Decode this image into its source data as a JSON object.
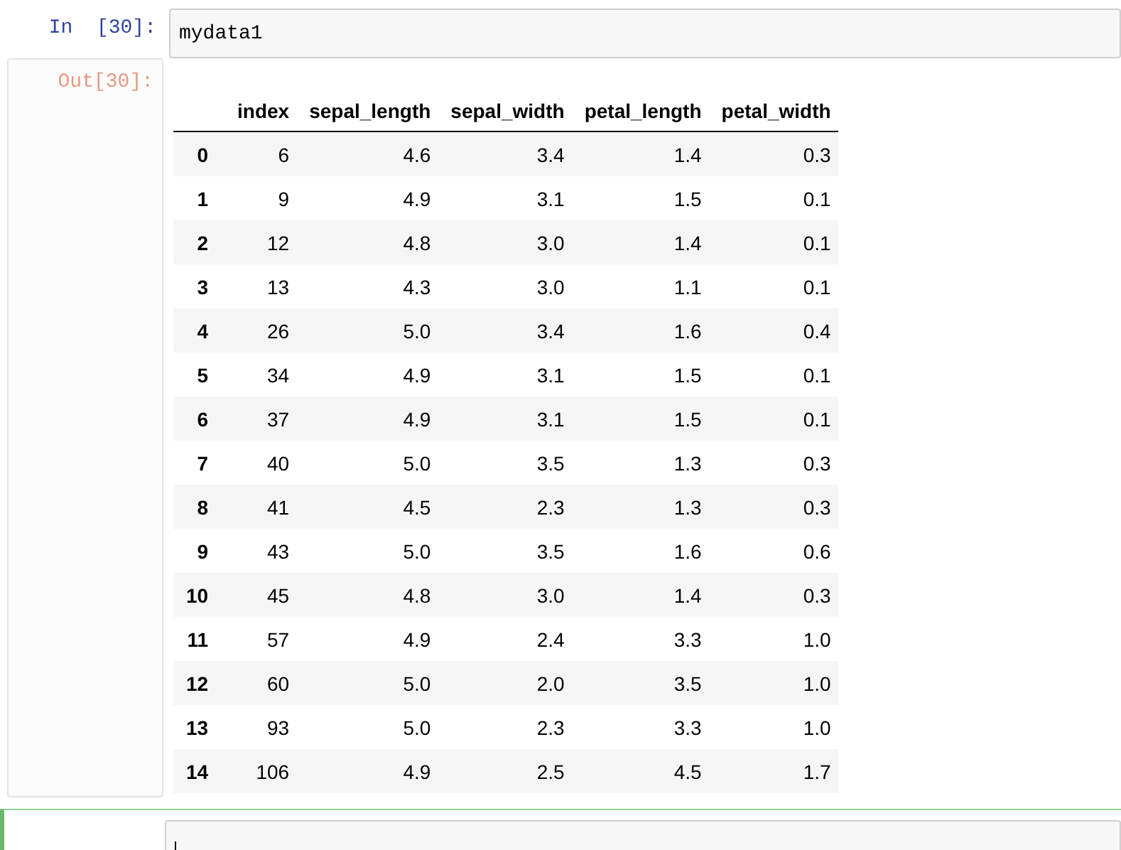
{
  "cells": [
    {
      "kind": "code",
      "prompt": "In  [30]:",
      "source": "mydata1",
      "selected": false,
      "output": {
        "prompt": "Out[30]:",
        "table": {
          "columns": [
            "index",
            "sepal_length",
            "sepal_width",
            "petal_length",
            "petal_width"
          ],
          "rows": [
            {
              "label": "0",
              "values": [
                "6",
                "4.6",
                "3.4",
                "1.4",
                "0.3"
              ]
            },
            {
              "label": "1",
              "values": [
                "9",
                "4.9",
                "3.1",
                "1.5",
                "0.1"
              ]
            },
            {
              "label": "2",
              "values": [
                "12",
                "4.8",
                "3.0",
                "1.4",
                "0.1"
              ]
            },
            {
              "label": "3",
              "values": [
                "13",
                "4.3",
                "3.0",
                "1.1",
                "0.1"
              ]
            },
            {
              "label": "4",
              "values": [
                "26",
                "5.0",
                "3.4",
                "1.6",
                "0.4"
              ]
            },
            {
              "label": "5",
              "values": [
                "34",
                "4.9",
                "3.1",
                "1.5",
                "0.1"
              ]
            },
            {
              "label": "6",
              "values": [
                "37",
                "4.9",
                "3.1",
                "1.5",
                "0.1"
              ]
            },
            {
              "label": "7",
              "values": [
                "40",
                "5.0",
                "3.5",
                "1.3",
                "0.3"
              ]
            },
            {
              "label": "8",
              "values": [
                "41",
                "4.5",
                "2.3",
                "1.3",
                "0.3"
              ]
            },
            {
              "label": "9",
              "values": [
                "43",
                "5.0",
                "3.5",
                "1.6",
                "0.6"
              ]
            },
            {
              "label": "10",
              "values": [
                "45",
                "4.8",
                "3.0",
                "1.4",
                "0.3"
              ]
            },
            {
              "label": "11",
              "values": [
                "57",
                "4.9",
                "2.4",
                "3.3",
                "1.0"
              ]
            },
            {
              "label": "12",
              "values": [
                "60",
                "5.0",
                "2.0",
                "3.5",
                "1.0"
              ]
            },
            {
              "label": "13",
              "values": [
                "93",
                "5.0",
                "2.3",
                "3.3",
                "1.0"
              ]
            },
            {
              "label": "14",
              "values": [
                "106",
                "4.9",
                "2.5",
                "4.5",
                "1.7"
              ]
            }
          ]
        }
      }
    },
    {
      "kind": "code",
      "selected": true
    }
  ]
}
